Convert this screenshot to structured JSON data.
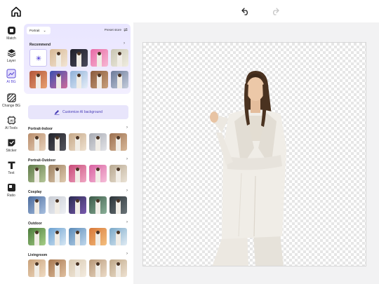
{
  "colors": {
    "accent": "#5b4bd6",
    "panel_bg": "#e9e6ff",
    "workarea": "#f2f2f3"
  },
  "toolbar": {
    "home_icon": "home-icon",
    "undo_icon": "undo-icon",
    "redo_icon": "redo-icon"
  },
  "rail": {
    "items": [
      {
        "label": "Match",
        "icon": "match-icon"
      },
      {
        "label": "Layer",
        "icon": "layers-icon"
      },
      {
        "label": "AI BG",
        "icon": "ai-bg-icon",
        "active": true
      },
      {
        "label": "Change BG",
        "icon": "change-bg-icon"
      },
      {
        "label": "AI Tools",
        "icon": "ai-tools-icon"
      },
      {
        "label": "Sticker",
        "icon": "sticker-icon"
      },
      {
        "label": "Text",
        "icon": "text-icon"
      },
      {
        "label": "Ratio",
        "icon": "ratio-icon"
      }
    ]
  },
  "panel": {
    "dropdown_value": "Portrait",
    "toggle_label": "Preset store",
    "custom_button": "Customize AI background",
    "sections": [
      {
        "title": "Recommend"
      },
      {
        "title": "Portrait-Indoor"
      },
      {
        "title": "Portrait-Outdoor"
      },
      {
        "title": "Cosplay"
      },
      {
        "title": "Outdoor"
      },
      {
        "title": "Livingroom"
      }
    ]
  }
}
